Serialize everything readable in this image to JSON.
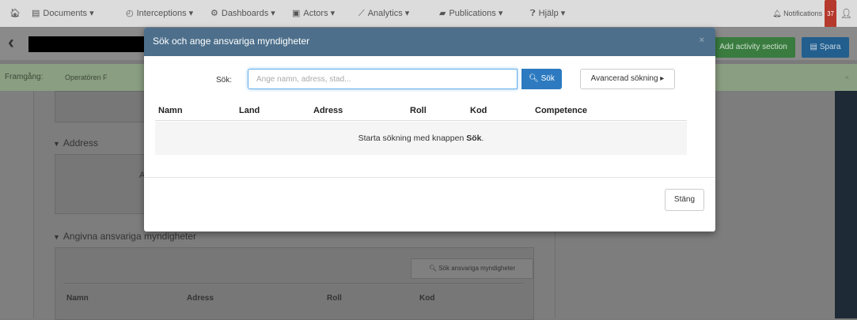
{
  "topnav": {
    "items": [
      {
        "label": "Documents ▾"
      },
      {
        "label": "Interceptions ▾"
      },
      {
        "label": "Dashboards ▾"
      },
      {
        "label": "Actors ▾"
      },
      {
        "label": "Analytics ▾"
      },
      {
        "label": "Publications ▾"
      },
      {
        "label": "Hjälp ▾"
      }
    ],
    "notifications_label": "Notifications",
    "notifications_count": "37"
  },
  "page": {
    "add_activity_label": "Add activity section",
    "save_label": "Spara",
    "alert_label": "Framgång:",
    "alert_text": "Operatören F",
    "address_heading": "Address",
    "address_fragment": "A",
    "authorities_heading": "Angivna ansvariga myndigheter",
    "search_authorities_label": "Sök ansvariga myndigheter",
    "table_headers": [
      "Namn",
      "Adress",
      "Roll",
      "Kod"
    ]
  },
  "modal": {
    "title": "Sök och ange ansvariga myndigheter",
    "close": "×",
    "search_label": "Sök:",
    "search_placeholder": "Ange namn, adress, stad...",
    "search_value": "",
    "search_button": "Sök",
    "advanced_button": "Avancerad sökning ▸",
    "columns": [
      "Namn",
      "Land",
      "Adress",
      "Roll",
      "Kod",
      "Competence"
    ],
    "empty_text_prefix": "Starta sökning med knappen ",
    "empty_text_bold": "Sök",
    "empty_text_suffix": ".",
    "close_button": "Stäng"
  }
}
